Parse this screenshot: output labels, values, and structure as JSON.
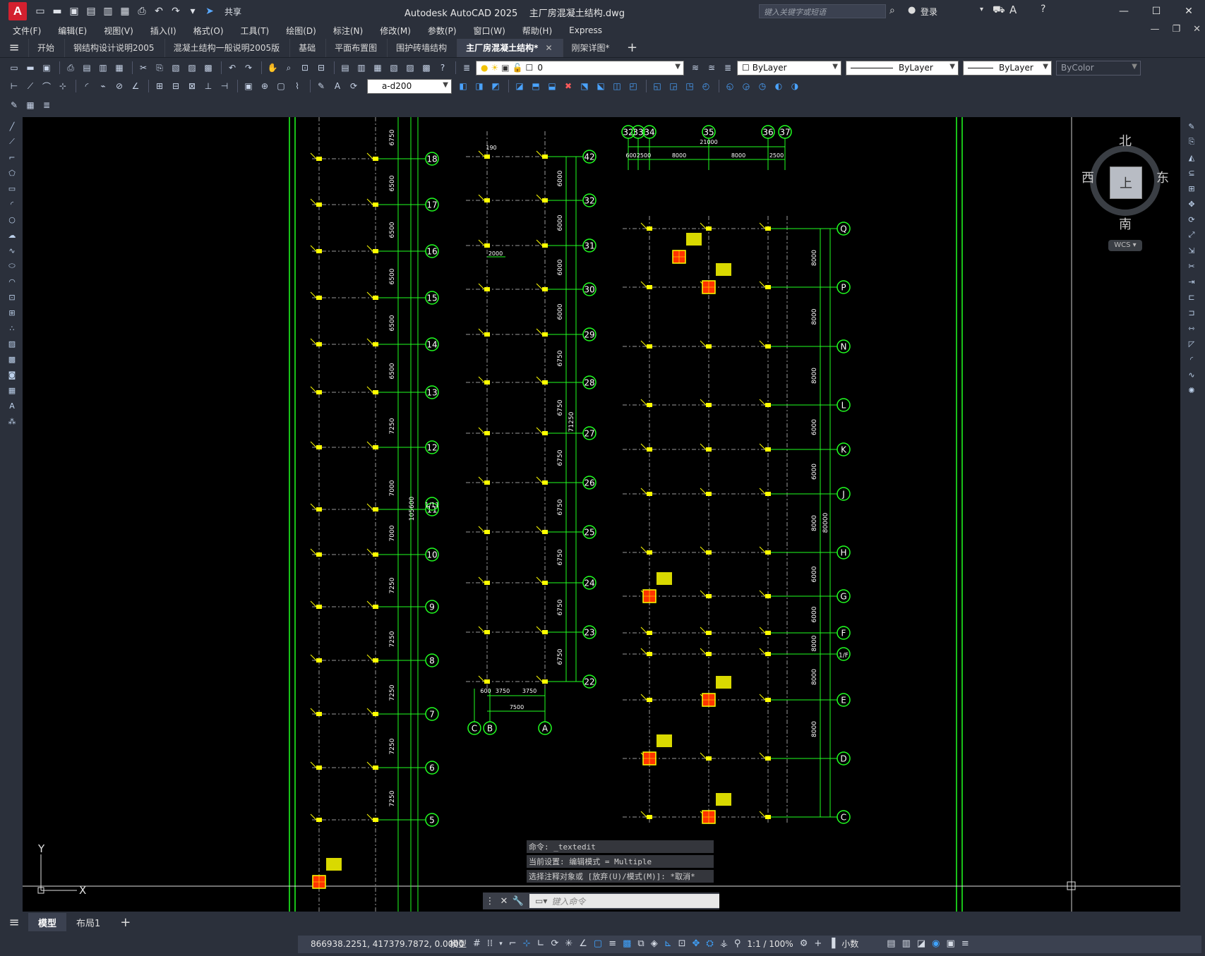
{
  "titlebar": {
    "app_title": "Autodesk AutoCAD 2025",
    "document": "主厂房混凝土结构.dwg",
    "share_label": "共享",
    "search_placeholder": "键入关键字或短语",
    "login_label": "登录"
  },
  "menu": [
    "文件(F)",
    "编辑(E)",
    "视图(V)",
    "插入(I)",
    "格式(O)",
    "工具(T)",
    "绘图(D)",
    "标注(N)",
    "修改(M)",
    "参数(P)",
    "窗口(W)",
    "帮助(H)",
    "Express"
  ],
  "tabs": [
    {
      "label": "开始",
      "active": false
    },
    {
      "label": "钢结构设计说明2005",
      "active": false
    },
    {
      "label": "混凝土结构一般说明2005版",
      "active": false
    },
    {
      "label": "基础",
      "active": false
    },
    {
      "label": "平面布置图",
      "active": false
    },
    {
      "label": "围护砖墙结构",
      "active": false
    },
    {
      "label": "主厂房混凝土结构*",
      "active": true
    },
    {
      "label": "刚架详图*",
      "active": false
    }
  ],
  "toolbar": {
    "layer_value": "0",
    "color_value": "ByLayer",
    "linetype_value": "ByLayer",
    "lineweight_value": "ByLayer",
    "plotstyle_value": "ByColor",
    "dimstyle_value": "a-d200"
  },
  "viewcube": {
    "north": "北",
    "south": "南",
    "east": "东",
    "west": "西",
    "top_face": "上",
    "wcs": "WCS"
  },
  "drawing": {
    "left_grid_labels": [
      "18",
      "17",
      "16",
      "15",
      "14",
      "13",
      "12",
      "11",
      "10",
      "9",
      "8",
      "7",
      "6",
      "5"
    ],
    "left_dims": [
      "6750",
      "6500",
      "6500",
      "6500",
      "6500",
      "6500",
      "7250",
      "7000",
      "7000",
      "7250",
      "7250",
      "7250",
      "7250",
      "7250",
      "7250"
    ],
    "left_extra": [
      "1/11",
      "105600"
    ],
    "mid_grid_labels": [
      "42",
      "32",
      "31",
      "30",
      "29",
      "28",
      "27",
      "26",
      "25",
      "24",
      "23",
      "22"
    ],
    "mid_dims": [
      "6000",
      "6000",
      "6000",
      "6000",
      "6750",
      "6750",
      "6750",
      "6750",
      "6750",
      "6750",
      "6750",
      "6750"
    ],
    "mid_total": "71250",
    "mid_bottom_labels": [
      "C",
      "B",
      "A"
    ],
    "mid_bottom_dims": [
      "600",
      "3750",
      "3750",
      "7500"
    ],
    "mid_small": [
      "190",
      "2000"
    ],
    "right_top_labels": [
      "32",
      "33",
      "34",
      "35",
      "36",
      "37"
    ],
    "right_top_dims": [
      "21000",
      "600",
      "2500",
      "8000",
      "8000",
      "2500"
    ],
    "right_grid_labels": [
      "Q",
      "P",
      "N",
      "L",
      "K",
      "J",
      "H",
      "G",
      "F",
      "1/F",
      "E",
      "D",
      "C"
    ],
    "right_dims": [
      "8000",
      "8000",
      "8000",
      "6000",
      "6000",
      "8000",
      "6000",
      "6000",
      "8000",
      "8000",
      "8000"
    ],
    "right_total": "80000"
  },
  "command": {
    "history": [
      "命令: _textedit",
      "当前设置: 编辑模式 = Multiple",
      "选择注释对象或 [放弃(U)/模式(M)]: *取消*"
    ],
    "placeholder": "键入命令"
  },
  "layout_tabs": [
    "模型",
    "布局1"
  ],
  "status": {
    "coords": "866938.2251, 417379.7872, 0.0000",
    "model_label": "模型",
    "scale": "1:1 / 100%",
    "units": "小数"
  },
  "colors": {
    "grid": "#21ff21",
    "column": "#ffff00",
    "bg": "#000000",
    "highlight": "#ff3300"
  }
}
